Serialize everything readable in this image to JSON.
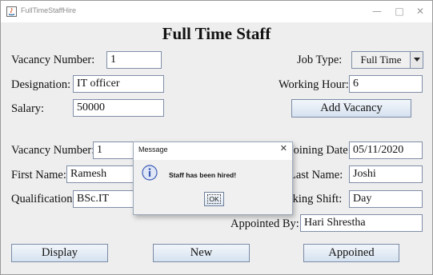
{
  "window": {
    "title": "FullTimeStaffHire",
    "controls": {
      "minimize": "—",
      "maximize": "□",
      "close": "✕"
    }
  },
  "form": {
    "heading": "Full Time Staff",
    "vacancy_section": {
      "vacancy_number_label": "Vacancy Number:",
      "vacancy_number_value": "1",
      "job_type_label": "Job Type:",
      "job_type_value": "Full Time",
      "designation_label": "Designation:",
      "designation_value": "IT officer",
      "working_hour_label": "Working Hour:",
      "working_hour_value": "6",
      "salary_label": "Salary:",
      "salary_value": "50000",
      "add_vacancy_button": "Add Vacancy"
    },
    "appoint_section": {
      "vacancy_number_label": "Vacancy Number:",
      "vacancy_number_value": "1",
      "joining_date_label": "Joining Date:",
      "joining_date_value": "05/11/2020",
      "first_name_label": "First Name:",
      "first_name_value": "Ramesh",
      "last_name_label": "Last Name:",
      "last_name_value": "Joshi",
      "qualification_label": "Qualification:",
      "qualification_value": "BSc.IT",
      "working_shift_label": "Working Shift:",
      "working_shift_value": "Day",
      "appointed_by_label": "Appointed By:",
      "appointed_by_value": "Hari Shrestha"
    },
    "buttons": {
      "display": "Display",
      "new": "New",
      "appoint": "Appoined"
    }
  },
  "dialog": {
    "title": "Message",
    "close": "✕",
    "message": "Staff has been hired!",
    "ok": "OK",
    "icon": "info-icon"
  },
  "colors": {
    "info_blue": "#3b5bb5",
    "button_border": "#7a8ba6",
    "field_border": "#7f8ea7"
  }
}
